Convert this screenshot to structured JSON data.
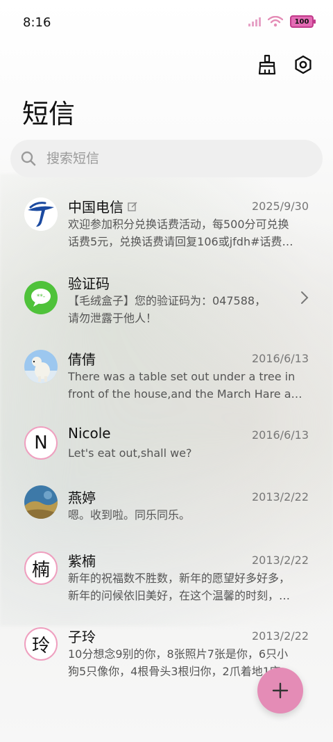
{
  "status": {
    "time": "8:16",
    "battery": "100"
  },
  "header": {
    "title": "短信"
  },
  "search": {
    "placeholder": "搜索短信"
  },
  "conversations": [
    {
      "name": "中国电信",
      "date": "2025/9/30",
      "lines": [
        "欢迎参加积分兑换话费活动，每500分可兑换",
        "话费5元，兑换话费请回复106或jfdh#话费…"
      ],
      "avatar": "china-telecom-logo"
    },
    {
      "name": "验证码",
      "date": "",
      "lines": [
        "【毛绒盒子】您的验证码为：047588，",
        "请勿泄露于他人！"
      ],
      "avatar": "message-bubble-icon"
    },
    {
      "name": "倩倩",
      "date": "2016/6/13",
      "lines": [
        "There was a table set out under a tree in",
        "front of the house,and the March Hare an…"
      ],
      "avatar": "polar-bear-photo"
    },
    {
      "name": "Nicole",
      "date": "2016/6/13",
      "lines": [
        "Let's eat out,shall we?"
      ],
      "avatar_letter": "N"
    },
    {
      "name": "燕婷",
      "date": "2013/2/22",
      "lines": [
        "嗯。收到啦。同乐同乐。"
      ],
      "avatar": "landscape-photo"
    },
    {
      "name": "紫楠",
      "date": "2013/2/22",
      "lines": [
        "新年的祝福数不胜数，新年的愿望好多好多，",
        "新年的问候依旧美好，在这个温馨的时刻，…"
      ],
      "avatar_letter": "楠"
    },
    {
      "name": "子玲",
      "date": "2013/2/22",
      "lines": [
        "10分想念9别的你，8张照片7张是你，6只小",
        "狗5只像你，4根骨头3根归你，2爪着地1定…"
      ],
      "avatar_letter": "玲"
    }
  ],
  "fab": {
    "icon": "plus-icon"
  },
  "colors": {
    "accent": "#e48cb6",
    "avatar_border": "#ef9fbf",
    "battery": "#e36bb4"
  }
}
